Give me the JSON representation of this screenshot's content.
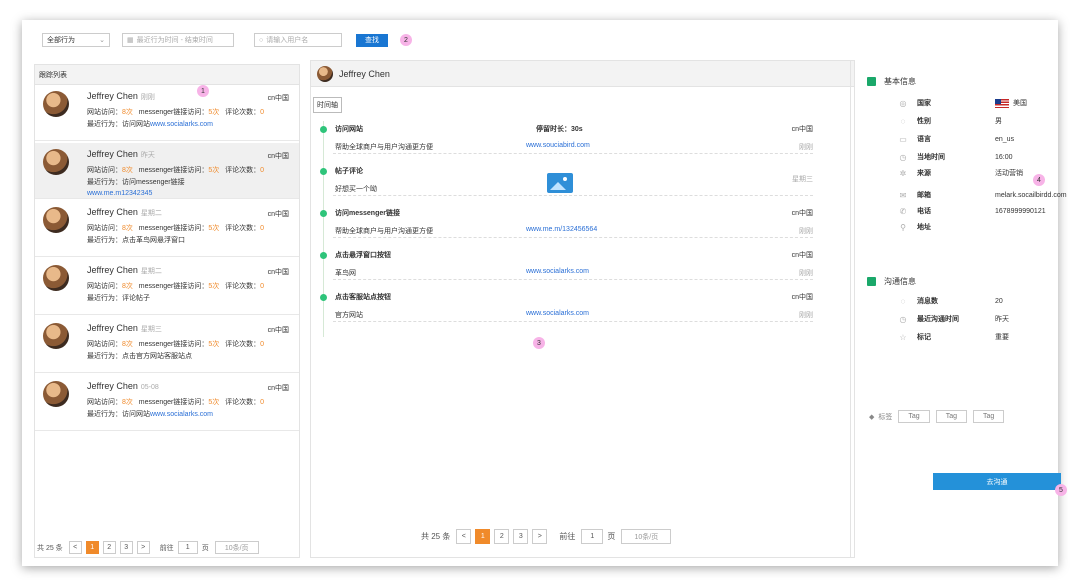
{
  "toolbar": {
    "behavior_select": "全部行为",
    "date_placeholder": "最近行为时间 - 结束时间",
    "search_placeholder": "请输入用户名",
    "search_button": "查找"
  },
  "badges": {
    "b1": "1",
    "b2": "2",
    "b3": "3",
    "b4": "4",
    "b5": "5"
  },
  "left": {
    "title": "跟踪列表",
    "items": [
      {
        "name": "Jeffrey Chen",
        "time": "刚刚",
        "country": "cn中国",
        "visits_label": "网站访问：",
        "visits": "8次",
        "msg_label": "messenger链接访问：",
        "msg": "5次",
        "comments_label": "评论次数：",
        "comments": "0",
        "recent_label": "最近行为：",
        "recent": "访问网站",
        "recent_link": "www.socialarks.com",
        "recent_extra": "",
        "selected": false
      },
      {
        "name": "Jeffrey Chen",
        "time": "昨天",
        "country": "cn中国",
        "visits_label": "网站访问：",
        "visits": "8次",
        "msg_label": "messenger链接访问：",
        "msg": "5次",
        "comments_label": "评论次数：",
        "comments": "0",
        "recent_label": "最近行为：",
        "recent": "访问messenger链接",
        "recent_link": "",
        "recent_extra": "www.me.m12342345",
        "selected": true
      },
      {
        "name": "Jeffrey Chen",
        "time": "星期二",
        "country": "cn中国",
        "visits_label": "网站访问：",
        "visits": "8次",
        "msg_label": "messenger链接访问：",
        "msg": "5次",
        "comments_label": "评论次数：",
        "comments": "0",
        "recent_label": "最近行为：",
        "recent": "点击革鸟网悬浮窗口",
        "recent_link": "",
        "recent_extra": "",
        "selected": false
      },
      {
        "name": "Jeffrey Chen",
        "time": "星期二",
        "country": "cn中国",
        "visits_label": "网站访问：",
        "visits": "8次",
        "msg_label": "messenger链接访问：",
        "msg": "5次",
        "comments_label": "评论次数：",
        "comments": "0",
        "recent_label": "最近行为：",
        "recent": "评论帖子",
        "recent_link": "",
        "recent_extra": "",
        "selected": false
      },
      {
        "name": "Jeffrey Chen",
        "time": "星期三",
        "country": "cn中国",
        "visits_label": "网站访问：",
        "visits": "8次",
        "msg_label": "messenger链接访问：",
        "msg": "5次",
        "comments_label": "评论次数：",
        "comments": "0",
        "recent_label": "最近行为：",
        "recent": "点击官方网站客服站点",
        "recent_link": "",
        "recent_extra": "",
        "selected": false
      },
      {
        "name": "Jeffrey Chen",
        "time": "05-08",
        "country": "cn中国",
        "visits_label": "网站访问：",
        "visits": "8次",
        "msg_label": "messenger链接访问：",
        "msg": "5次",
        "comments_label": "评论次数：",
        "comments": "0",
        "recent_label": "最近行为：",
        "recent": "访问网站",
        "recent_link": "www.socialarks.com",
        "recent_extra": "",
        "selected": false
      }
    ],
    "pager": {
      "total": "共 25 条",
      "pages": [
        "1",
        "2",
        "3"
      ],
      "goto": "前往",
      "goto_value": "1",
      "page_unit": "页",
      "size": "10条/页"
    }
  },
  "mid": {
    "name": "Jeffrey Chen",
    "tab": "时间轴",
    "events": [
      {
        "title": "访问网站",
        "extra": "停留时长：30s",
        "desc": "帮助全球商户与用户沟通更方便",
        "link": "www.souciabird.com",
        "right_top": "cn中国",
        "right_bottom": "刚刚",
        "image": false
      },
      {
        "title": "帖子评论",
        "extra": "",
        "desc": "好想买一个呦",
        "link": "",
        "right_top": "",
        "right_bottom": "星期三",
        "image": true
      },
      {
        "title": "访问messenger链接",
        "extra": "",
        "desc": "帮助全球商户与用户沟通更方便",
        "link": "www.me.m/132456564",
        "right_top": "cn中国",
        "right_bottom": "刚刚",
        "image": false
      },
      {
        "title": "点击悬浮窗口按钮",
        "extra": "",
        "desc": "革鸟网",
        "link": "www.socialarks.com",
        "right_top": "cn中国",
        "right_bottom": "刚刚",
        "image": false
      },
      {
        "title": "点击客服站点按钮",
        "extra": "",
        "desc": "官方网站",
        "link": "www.socialarks.com",
        "right_top": "cn中国",
        "right_bottom": "刚刚",
        "image": false
      }
    ],
    "pager": {
      "total": "共 25 条",
      "pages": [
        "1",
        "2",
        "3"
      ],
      "goto": "前往",
      "goto_value": "1",
      "page_unit": "页",
      "size": "10条/页"
    }
  },
  "right": {
    "basic_title": "基本信息",
    "basic": [
      {
        "icon": "globe-icon",
        "glyph": "◎",
        "key": "国家",
        "value": "美国",
        "flag": true
      },
      {
        "icon": "gender-icon",
        "glyph": "◌",
        "key": "性别",
        "value": "男",
        "flag": false
      },
      {
        "icon": "language-icon",
        "glyph": "▭",
        "key": "语言",
        "value": "en_us",
        "flag": false
      },
      {
        "icon": "clock-icon",
        "glyph": "◷",
        "key": "当地时间",
        "value": "16:00",
        "flag": false
      },
      {
        "icon": "source-icon",
        "glyph": "✲",
        "key": "来源",
        "value": "活动营销",
        "flag": false
      },
      {
        "icon": "mail-icon",
        "glyph": "✉",
        "key": "邮箱",
        "value": "melark.socailbirdd.com",
        "flag": false
      },
      {
        "icon": "phone-icon",
        "glyph": "✆",
        "key": "电话",
        "value": "1678999990121",
        "flag": false
      },
      {
        "icon": "location-icon",
        "glyph": "⚲",
        "key": "地址",
        "value": "",
        "flag": false
      }
    ],
    "contact_title": "沟通信息",
    "contact": [
      {
        "icon": "message-icon",
        "glyph": "◌",
        "key": "消息数",
        "value": "20"
      },
      {
        "icon": "clock-icon",
        "glyph": "◷",
        "key": "最近沟通时间",
        "value": "昨天"
      },
      {
        "icon": "star-icon",
        "glyph": "☆",
        "key": "标记",
        "value": "重要"
      }
    ],
    "tags_label": "标签",
    "tags": [
      "Tag",
      "Tag",
      "Tag"
    ],
    "action_button": "去沟通"
  }
}
